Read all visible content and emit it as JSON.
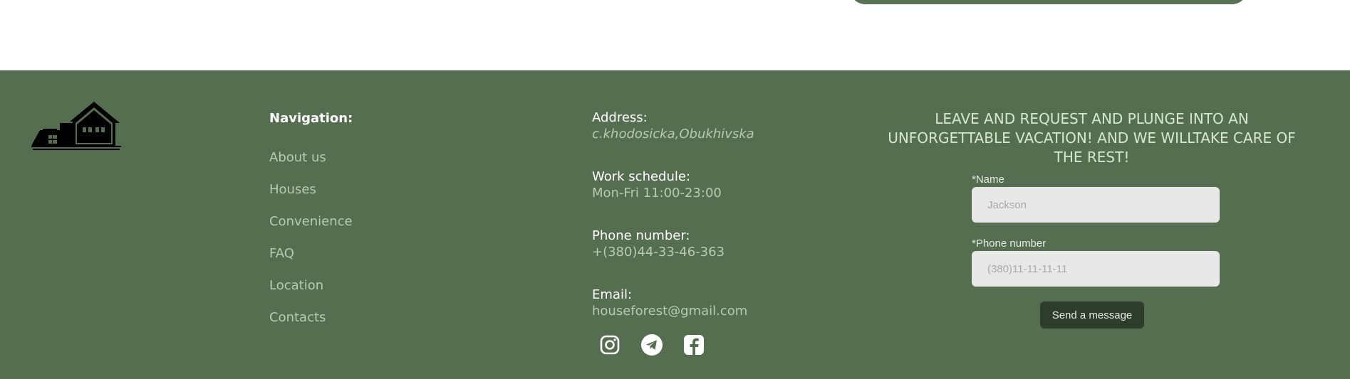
{
  "colors": {
    "footer_bg": "#546e4f",
    "top_pill": "#577352",
    "link": "#b9c9b3",
    "cta_text": "#d6e6cf",
    "input_bg": "#e8e8e8",
    "button_bg": "#2e3d2b"
  },
  "logo": {
    "icon": "house-logo-icon"
  },
  "navigation": {
    "title": "Navigation:",
    "items": [
      "About us",
      "Houses",
      "Convenience",
      "FAQ",
      "Location",
      "Contacts"
    ]
  },
  "contact_info": {
    "address_label": "Address:",
    "address_value": "c.khodosicka,Obukhivska",
    "schedule_label": "Work schedule:",
    "schedule_value": "Mon-Fri 11:00-23:00",
    "phone_label": "Phone number:",
    "phone_value": "+(380)44-33-46-363",
    "email_label": "Email:",
    "email_value": "houseforest@gmail.com"
  },
  "socials": [
    {
      "icon": "instagram-icon"
    },
    {
      "icon": "telegram-icon"
    },
    {
      "icon": "facebook-icon"
    }
  ],
  "request_form": {
    "cta": "LEAVE AND REQUEST AND PLUNGE INTO AN UNFORGETTABLE VACATION! AND WE WILLTAKE CARE OF THE REST!",
    "name_label": "*Name",
    "name_placeholder": "Jackson",
    "phone_label": "*Phone number",
    "phone_placeholder": "(380)11-11-11-11",
    "submit_label": "Send a message"
  }
}
